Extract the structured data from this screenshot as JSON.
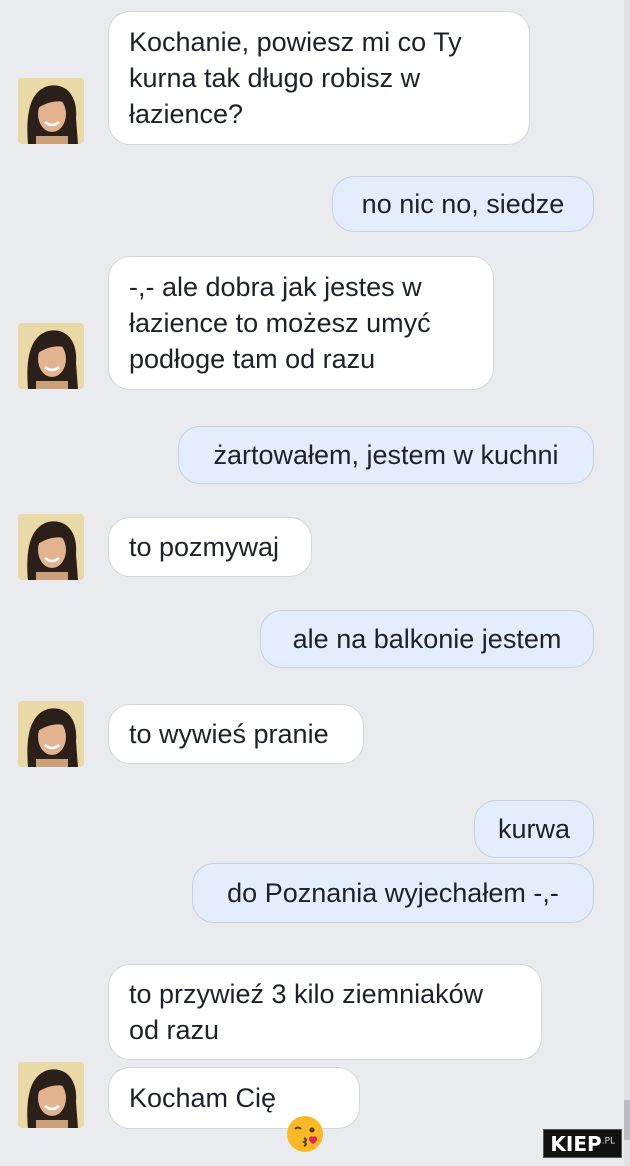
{
  "messages": [
    {
      "side": "in",
      "text": "Kochanie, powiesz mi co Ty\nkurna tak długo robisz w\nłazience?"
    },
    {
      "side": "out",
      "text": "no nic no, siedze"
    },
    {
      "side": "in",
      "text": "-,- ale dobra jak jestes w\nłazience to możesz umyć\npodłoge tam od razu"
    },
    {
      "side": "out",
      "text": "żartowałem, jestem w kuchni"
    },
    {
      "side": "in",
      "text": "to pozmywaj"
    },
    {
      "side": "out",
      "text": "ale na balkonie jestem"
    },
    {
      "side": "in",
      "text": "to wywieś pranie"
    },
    {
      "side": "out",
      "text": "kurwa"
    },
    {
      "side": "out",
      "text": "do Poznania wyjechałem -,-"
    },
    {
      "side": "in",
      "text": "to przywieź 3 kilo ziemniaków\nod razu"
    },
    {
      "side": "in",
      "text": "Kocham Cię",
      "emoji": "kissing-face-emoji"
    }
  ],
  "watermark": {
    "main": "KIEP",
    "suffix": ".PL"
  },
  "colors": {
    "background": "#e9ebee",
    "incoming_bubble": "#ffffff",
    "outgoing_bubble": "#e3edfb",
    "text": "#1d2129"
  }
}
